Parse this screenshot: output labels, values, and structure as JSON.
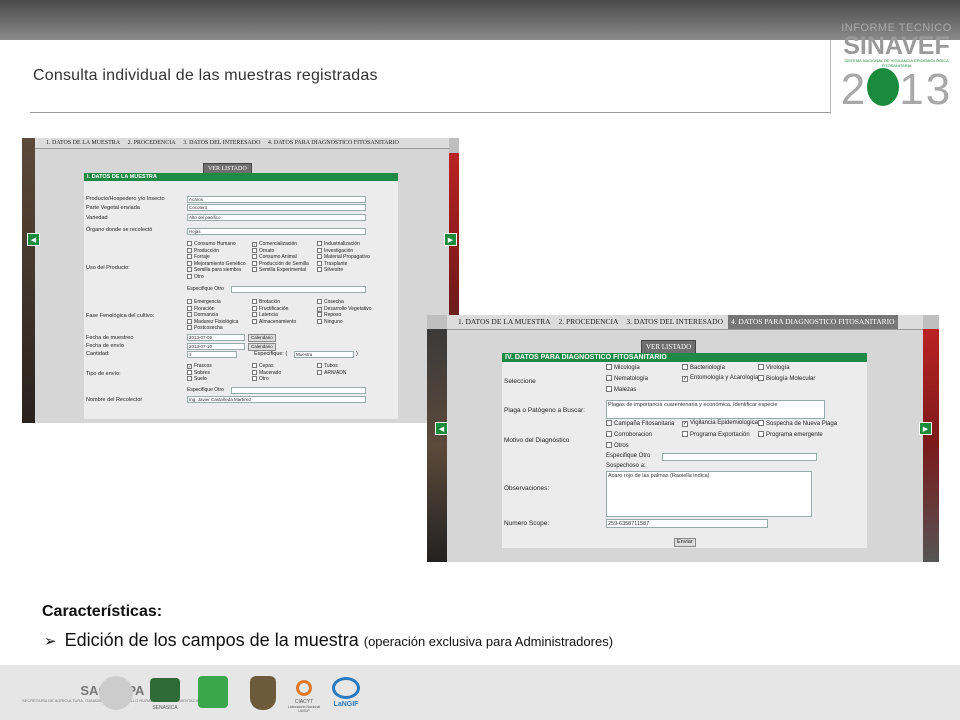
{
  "slide": {
    "title": "Consulta individual de las muestras registradas",
    "logo": {
      "top": "INFORME TECNICO",
      "main": "SINAVEF",
      "sub": "SISTEMA NACIONAL DE VIGILANCIA EPIDEMIOLÓGICA FITOSANITARIA",
      "year_a": "2",
      "year_b": "13"
    }
  },
  "shot1": {
    "tabs": [
      "1. DATOS DE LA MUESTRA",
      "2. PROCEDENCIA",
      "3. DATOS DEL INTERESADO",
      "4. DATOS PARA DIAGNOSTICO FITOSANITARIO"
    ],
    "ver_listado": "VER LISTADO",
    "section": "I. DATOS DE LA MUESTRA",
    "labels": {
      "producto": "Producto/Hospedero y/o Insecto",
      "parte": "Parte Vegetal enviada",
      "variedad": "Variedad",
      "organo": "Órgano donde se recolectó",
      "uso": "Uso del Producto:",
      "fase": "Fase Fenológica del cultivo:",
      "fecha_muestreo": "Fecha de muestreo",
      "fecha_envio": "Fecha de envío",
      "cantidad": "Cantidad:",
      "tipo_envio": "Tipo de envío:",
      "recolector": "Nombre del Recolector"
    },
    "values": {
      "producto": "Acaros",
      "parte": "Cocotero",
      "variedad": "Alto del pacifico",
      "organo": "Hojas",
      "fecha_muestreo": "2013-07-09",
      "fecha_envio": "2013-07-10",
      "cantidad": "1",
      "especifique_unidad": "Muestra",
      "recolector": "Ing. Javier Castañeda Martinez"
    },
    "calendario": "Calendario",
    "especifique": "Especifique: (",
    "especifique_close": ")",
    "especifique_otro": "Especifique Otro",
    "uso_options": [
      {
        "label": "Consumo Humano",
        "checked": false
      },
      {
        "label": "Comercialización",
        "checked": true
      },
      {
        "label": "Industrialización",
        "checked": false
      },
      {
        "label": "Producción",
        "checked": false
      },
      {
        "label": "Ornato",
        "checked": false
      },
      {
        "label": "Investigación",
        "checked": false
      },
      {
        "label": "Forraje",
        "checked": false
      },
      {
        "label": "Consumo Animal",
        "checked": false
      },
      {
        "label": "Material Propagativo",
        "checked": false
      },
      {
        "label": "Mejoramiento Genético",
        "checked": false
      },
      {
        "label": "Producción de Semilla",
        "checked": false
      },
      {
        "label": "Trasplante",
        "checked": false
      },
      {
        "label": "Semilla para siembra",
        "checked": false
      },
      {
        "label": "Semilla Experimental",
        "checked": false
      },
      {
        "label": "Silvestre",
        "checked": false
      },
      {
        "label": "Otro",
        "checked": false
      }
    ],
    "fase_options": [
      {
        "label": "Emergencia",
        "checked": false
      },
      {
        "label": "Brotación",
        "checked": false
      },
      {
        "label": "Cosecha",
        "checked": false
      },
      {
        "label": "Floración",
        "checked": false
      },
      {
        "label": "Fructificación",
        "checked": false
      },
      {
        "label": "Desarrollo Vegetativo",
        "checked": true
      },
      {
        "label": "Dormancia",
        "checked": false
      },
      {
        "label": "Latencia",
        "checked": false
      },
      {
        "label": "Reposo",
        "checked": false
      },
      {
        "label": "Madurez Fisiológica",
        "checked": false
      },
      {
        "label": "Almacenamiento",
        "checked": false
      },
      {
        "label": "Ninguno",
        "checked": false
      },
      {
        "label": "Postcosecha",
        "checked": false
      }
    ],
    "envio_options": [
      {
        "label": "Frascos",
        "checked": true
      },
      {
        "label": "Cepas",
        "checked": false
      },
      {
        "label": "Tubos",
        "checked": false
      },
      {
        "label": "Sobres",
        "checked": false
      },
      {
        "label": "Macerado",
        "checked": false
      },
      {
        "label": "ARN/ADN",
        "checked": false
      },
      {
        "label": "Suelo",
        "checked": false
      },
      {
        "label": "Otro",
        "checked": false
      }
    ]
  },
  "shot2": {
    "tabs": [
      "1. DATOS DE LA MUESTRA",
      "2. PROCEDENCIA",
      "3. DATOS DEL INTERESADO",
      "4. DATOS PARA DIAGNOSTICO FITOSANITARIO"
    ],
    "ver_listado": "VER LISTADO",
    "section": "IV. DATOS PARA DIAGNOSTICO FITOSANITARIO",
    "labels": {
      "seleccione": "Seleccione",
      "plaga": "Plaga o Patógeno a Buscar:",
      "motivo": "Motivo del Diagnóstico",
      "observaciones": "Observaciones:",
      "scope": "Numero Scope:"
    },
    "seleccione_options": [
      {
        "label": "Micología",
        "checked": false
      },
      {
        "label": "Bacteriología",
        "checked": false
      },
      {
        "label": "Virología",
        "checked": false
      },
      {
        "label": "Nematología",
        "checked": false
      },
      {
        "label": "Entomología y Acarología",
        "checked": true
      },
      {
        "label": "Biología Molecular",
        "checked": false
      },
      {
        "label": "Malezas",
        "checked": false
      }
    ],
    "plaga_value": "Plagas de importancia cuarentenaria y económica. Identificar especie",
    "motivo_options": [
      {
        "label": "Campaña Fitosanitaria",
        "checked": false
      },
      {
        "label": "Vigilancia Epidemiologica",
        "checked": true
      },
      {
        "label": "Sospecha de Nueva Plaga",
        "checked": false
      },
      {
        "label": "Corroboracion",
        "checked": false
      },
      {
        "label": "Programa Exportación",
        "checked": false
      },
      {
        "label": "Programa emergente",
        "checked": false
      },
      {
        "label": "Otros",
        "checked": false
      }
    ],
    "especifique_otro": "Especifique Otro",
    "sospechoso": "Sospechoso a:",
    "observaciones_value": "Acaro rojo de las palmas (Raoiella indica)",
    "scope_value": "259-6358711587",
    "enviar": "Enviar"
  },
  "characteristics": {
    "title": "Características:",
    "bullet": "➢",
    "item": "Edición de los campos de la muestra",
    "note": "(operación exclusiva para Administradores)"
  },
  "footer": {
    "logos": [
      "SAGARPA",
      "SENASICA",
      "CIACYT",
      "LaNGIF"
    ],
    "sagarpa_sub": "SECRETARÍA DE AGRICULTURA, GANADERÍA, DESARROLLO RURAL, PESCA Y ALIMENTACIÓN",
    "ciacyt_sub": "Laboratorio Nacional UASLP"
  }
}
